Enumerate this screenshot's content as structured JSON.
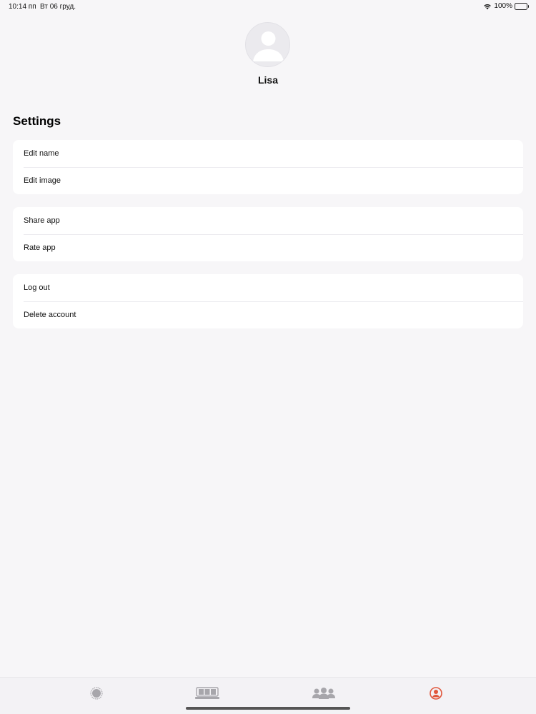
{
  "status_bar": {
    "time": "10:14 пп",
    "date": "Вт 06 груд.",
    "battery": "100%",
    "icons": [
      "wifi-icon",
      "battery-icon"
    ]
  },
  "profile": {
    "name": "Lisa",
    "avatar_icon": "person-placeholder-icon"
  },
  "settings": {
    "title": "Settings",
    "groups": [
      {
        "items": [
          {
            "label": "Edit name"
          },
          {
            "label": "Edit image"
          }
        ]
      },
      {
        "items": [
          {
            "label": "Share app"
          },
          {
            "label": "Rate app"
          }
        ]
      },
      {
        "items": [
          {
            "label": "Log out"
          },
          {
            "label": "Delete account"
          }
        ]
      }
    ]
  },
  "tab_bar": {
    "tabs": [
      {
        "icon": "radar-icon",
        "active": false
      },
      {
        "icon": "slot-machine-icon",
        "active": false
      },
      {
        "icon": "group-icon",
        "active": false
      },
      {
        "icon": "profile-icon",
        "active": true
      }
    ]
  },
  "colors": {
    "background": "#f7f6f8",
    "card": "#ffffff",
    "accent": "#e0563b",
    "inactive_icon": "#a7a6ab"
  }
}
